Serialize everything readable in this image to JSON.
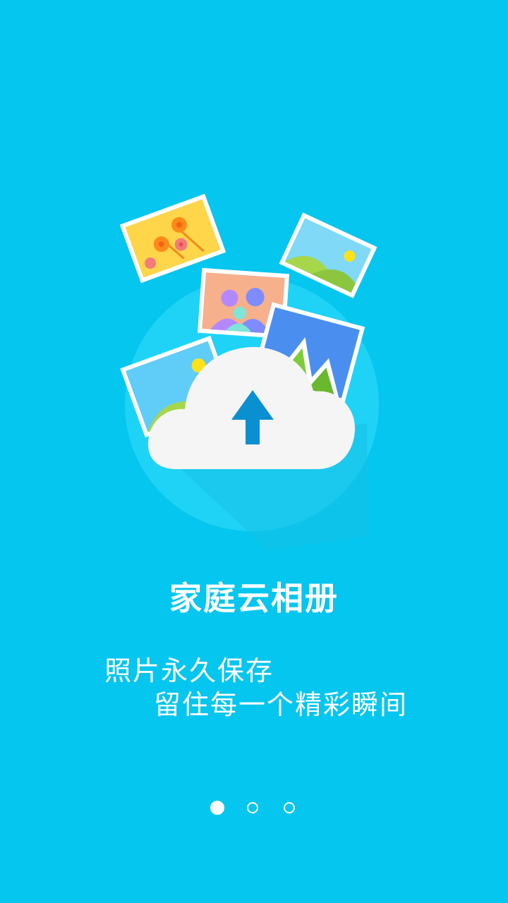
{
  "app": {
    "title": "家庭云相册",
    "tagline_line1": "照片永久保存",
    "tagline_line2": "留住每一个精彩瞬间"
  },
  "illustration": {
    "icons": [
      "photo-flowers-icon",
      "photo-landscape-icon",
      "photo-family-icon",
      "photo-mountain-icon",
      "cloud-upload-icon"
    ]
  },
  "pager": {
    "pages": 3,
    "active_index": 0
  },
  "colors": {
    "background": "#05c6ee",
    "circle": "#1fd3f7",
    "cloud": "#f5f5f5",
    "arrow": "#0a8fd0"
  }
}
